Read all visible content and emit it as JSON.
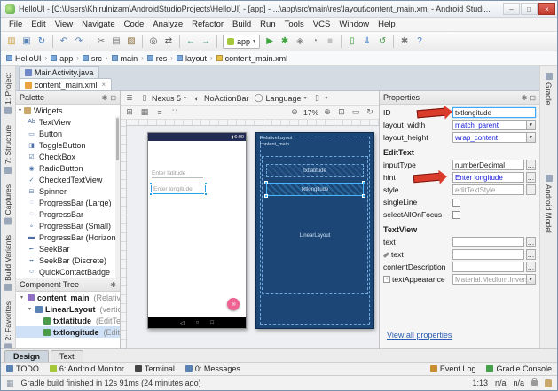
{
  "colors": {
    "arrow_red": "#da3b2b",
    "blueprint_blue": "#1b4675",
    "fab_pink": "#f06292",
    "selection_blue": "#28a0e8",
    "value_blue": "#1117d6",
    "link_blue": "#2a5db0",
    "android_green": "#a4c639"
  },
  "window": {
    "title": "HelloUI - [C:\\Users\\Khirulnizam\\AndroidStudioProjects\\HelloUI] - [app] - ...\\app\\src\\main\\res\\layout\\content_main.xml - Android Studi...",
    "controls": {
      "minimize": "–",
      "maximize": "□",
      "close": "×"
    }
  },
  "menubar": {
    "items": [
      "File",
      "Edit",
      "View",
      "Navigate",
      "Code",
      "Analyze",
      "Refactor",
      "Build",
      "Run",
      "Tools",
      "VCS",
      "Window",
      "Help"
    ]
  },
  "toolbar": {
    "run_config": "app",
    "icons": [
      {
        "name": "open-icon",
        "color": "#c89b3c"
      },
      {
        "name": "save-icon",
        "color": "#5b82b5"
      },
      {
        "name": "sync-icon",
        "color": "#3a78c2"
      },
      {
        "sep": true
      },
      {
        "name": "undo-icon",
        "color": "#5b82b5"
      },
      {
        "name": "redo-icon",
        "color": "#5b82b5"
      },
      {
        "sep": true
      },
      {
        "name": "cut-icon",
        "color": "#777777"
      },
      {
        "name": "copy-icon",
        "color": "#777777"
      },
      {
        "name": "paste-icon",
        "color": "#8a6d3b"
      },
      {
        "sep": true
      },
      {
        "name": "find-icon",
        "color": "#555555"
      },
      {
        "name": "replace-icon",
        "color": "#555555"
      },
      {
        "sep": true
      },
      {
        "name": "back-icon",
        "color": "#2c8f6e"
      },
      {
        "name": "forward-icon",
        "color": "#2c8f6e"
      },
      {
        "sep": true
      },
      {
        "name": "run-config"
      },
      {
        "name": "run-icon",
        "color": "#3fa33f"
      },
      {
        "name": "debug-icon",
        "color": "#3fa33f"
      },
      {
        "name": "coverage-icon",
        "color": "#888888"
      },
      {
        "name": "profiler-icon",
        "color": "#888888"
      },
      {
        "name": "stop-icon",
        "color": "#c2c2c2"
      },
      {
        "sep": true
      },
      {
        "name": "avd-manager-icon",
        "color": "#3fa33f"
      },
      {
        "name": "sdk-manager-icon",
        "color": "#3a78c2"
      },
      {
        "name": "gradle-sync-icon",
        "color": "#4a9b4a"
      },
      {
        "sep": true
      },
      {
        "name": "settings-icon",
        "color": "#777777"
      },
      {
        "name": "help-icon",
        "color": "#3a78c2"
      }
    ]
  },
  "breadcrumb": {
    "items": [
      {
        "label": "HelloUI",
        "icon": "folder-icon"
      },
      {
        "label": "app",
        "icon": "folder-icon"
      },
      {
        "label": "src",
        "icon": "folder-icon"
      },
      {
        "label": "main",
        "icon": "folder-icon"
      },
      {
        "label": "res",
        "icon": "folder-icon"
      },
      {
        "label": "layout",
        "icon": "folder-icon"
      },
      {
        "label": "content_main.xml",
        "icon": "xml-file-icon"
      }
    ]
  },
  "tool_strips": {
    "left": [
      "1: Project",
      "7: Structure",
      "Captures",
      "Build Variants",
      "2: Favorites"
    ],
    "right": [
      "Gradle",
      "Android Model"
    ]
  },
  "editor_tabs": {
    "inactive": {
      "label": "MainActivity.java"
    },
    "active": {
      "label": "content_main.xml",
      "close": "×"
    }
  },
  "palette": {
    "title": "Palette",
    "group": "Widgets",
    "items": [
      {
        "label": "TextView",
        "icon": "textview-icon"
      },
      {
        "label": "Button",
        "icon": "button-icon"
      },
      {
        "label": "ToggleButton",
        "icon": "togglebutton-icon"
      },
      {
        "label": "CheckBox",
        "icon": "checkbox-icon"
      },
      {
        "label": "RadioButton",
        "icon": "radiobutton-icon"
      },
      {
        "label": "CheckedTextView",
        "icon": "checkedtextview-icon"
      },
      {
        "label": "Spinner",
        "icon": "spinner-icon"
      },
      {
        "label": "ProgressBar (Large)",
        "icon": "progressbar-large-icon"
      },
      {
        "label": "ProgressBar",
        "icon": "progressbar-icon"
      },
      {
        "label": "ProgressBar (Small)",
        "icon": "progressbar-small-icon"
      },
      {
        "label": "ProgressBar (Horizontal)",
        "icon": "progressbar-horizontal-icon"
      },
      {
        "label": "SeekBar",
        "icon": "seekbar-icon"
      },
      {
        "label": "SeekBar (Discrete)",
        "icon": "seekbar-discrete-icon"
      },
      {
        "label": "QuickContactBadge",
        "icon": "quickcontactbadge-icon"
      }
    ]
  },
  "component_tree": {
    "title": "Component Tree",
    "items": [
      {
        "name": "content_main",
        "type": "(RelativeLa",
        "icon": "relativelayout-icon",
        "depth": 0,
        "expand": true,
        "selected": false
      },
      {
        "name": "LinearLayout",
        "type": "(vertical)",
        "icon": "linearlayout-icon",
        "depth": 1,
        "expand": true,
        "selected": false
      },
      {
        "name": "txtlatitude",
        "type": "(EditText)",
        "icon": "edittext-icon",
        "depth": 2,
        "expand": false,
        "selected": false
      },
      {
        "name": "txtlongitude",
        "type": "(EditText)",
        "icon": "edittext-icon",
        "depth": 2,
        "expand": false,
        "selected": true
      }
    ]
  },
  "design_toolbar": {
    "device_label": "Nexus 5",
    "theme_label": "NoActionBar",
    "language_label": "Language",
    "zoom_value": "17%"
  },
  "canvas": {
    "device_preview": {
      "status_time": "6:00",
      "edittext1_hint": "Enter latitude",
      "edittext2_hint": "Enter longitude"
    },
    "blueprint": {
      "root_label1": "RelativeLayout",
      "root_label2": "content_main",
      "box1": "txtlatitude",
      "box2": "txtlongitude",
      "layout_label": "LinearLayout"
    }
  },
  "properties": {
    "title": "Properties",
    "view_all": "View all properties",
    "rows": [
      {
        "kind": "field",
        "label": "ID",
        "value": "txtlongitude",
        "style": "input-focus"
      },
      {
        "kind": "field",
        "label": "layout_width",
        "value": "match_parent",
        "style": "dropdown",
        "color": "blue"
      },
      {
        "kind": "field",
        "label": "layout_height",
        "value": "wrap_content",
        "style": "dropdown",
        "color": "blue"
      },
      {
        "kind": "section",
        "label": "EditText"
      },
      {
        "kind": "field",
        "label": "inputType",
        "value": "numberDecimal",
        "style": "box",
        "more": true
      },
      {
        "kind": "field",
        "label": "hint",
        "value": "Enter longitude",
        "style": "box",
        "color": "blue",
        "more": true
      },
      {
        "kind": "field",
        "label": "style",
        "value": "editTextStyle",
        "style": "box",
        "color": "gray",
        "more": true
      },
      {
        "kind": "check",
        "label": "singleLine"
      },
      {
        "kind": "check",
        "label": "selectAllOnFocus"
      },
      {
        "kind": "section",
        "label": "TextView"
      },
      {
        "kind": "field",
        "label": "text",
        "value": "",
        "style": "box",
        "more": true
      },
      {
        "kind": "field",
        "label": "text",
        "icon": "wrench-icon",
        "value": "",
        "style": "box",
        "more": true
      },
      {
        "kind": "field",
        "label": "contentDescription",
        "value": "",
        "style": "box",
        "more": true
      },
      {
        "kind": "field",
        "label": "textAppearance",
        "icon": "expand-icon",
        "value": "Material.Medium.Inverse",
        "style": "dropdown",
        "color": "gray"
      }
    ]
  },
  "bottom_tabs": {
    "design": "Design",
    "text": "Text"
  },
  "bottom_bar": {
    "left": [
      {
        "label": "TODO",
        "icon": "todo-icon"
      },
      {
        "label": "6: Android Monitor",
        "icon": "android-monitor-icon"
      },
      {
        "label": "Terminal",
        "icon": "terminal-icon"
      },
      {
        "label": "0: Messages",
        "icon": "messages-icon"
      }
    ],
    "right": [
      {
        "label": "Event Log",
        "icon": "event-log-icon"
      },
      {
        "label": "Gradle Console",
        "icon": "gradle-console-icon"
      }
    ]
  },
  "statusbar": {
    "message": "Gradle build finished in 12s 91ms (24 minutes ago)",
    "caret_position": "1:13",
    "line_separator": "n/a",
    "encoding": "n/a"
  }
}
